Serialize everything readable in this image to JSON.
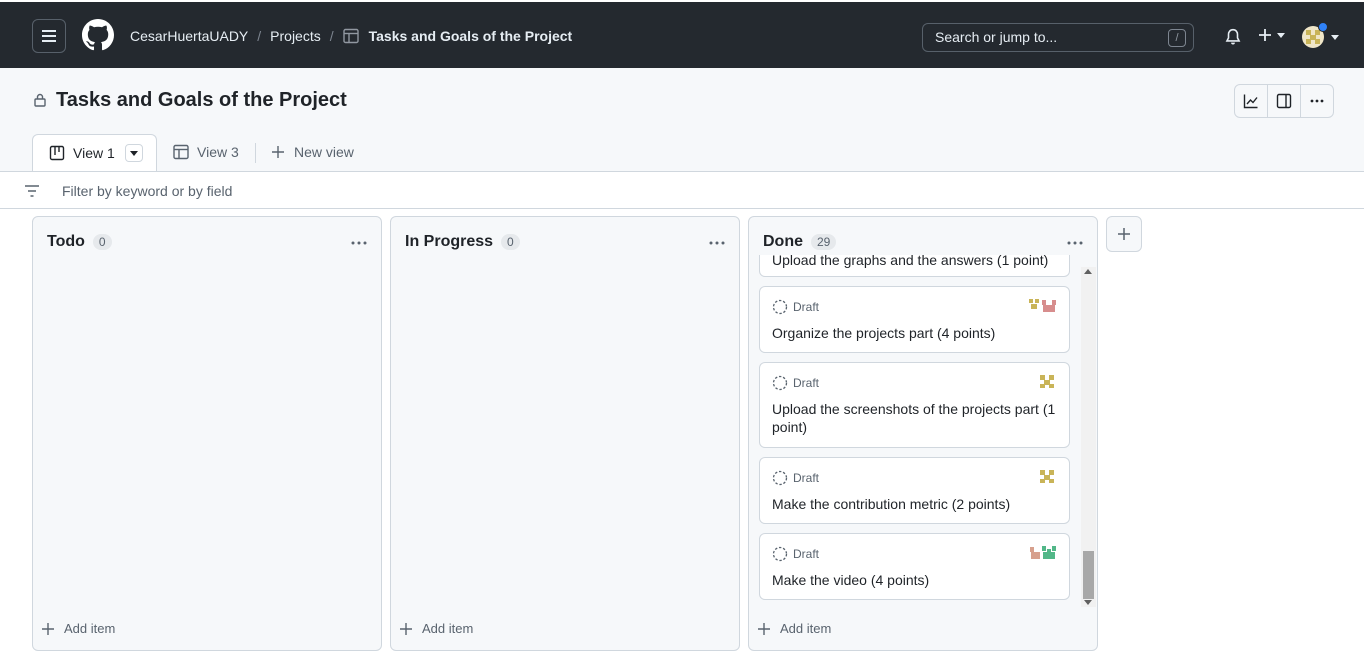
{
  "header": {
    "owner": "CesarHuertaUADY",
    "projects_label": "Projects",
    "project_title": "Tasks and Goals of the Project",
    "search_placeholder": "Search or jump to...",
    "search_shortcut": "/"
  },
  "project": {
    "title": "Tasks and Goals of the Project"
  },
  "tabs": [
    {
      "label": "View 1",
      "active": true,
      "icon": "board-icon"
    },
    {
      "label": "View 3",
      "active": false,
      "icon": "table-icon"
    },
    {
      "label": "New view",
      "active": false,
      "icon": "plus-icon"
    }
  ],
  "filter": {
    "placeholder": "Filter by keyword or by field"
  },
  "columns": [
    {
      "name": "Todo",
      "count": "0",
      "add_label": "Add item"
    },
    {
      "name": "In Progress",
      "count": "0",
      "add_label": "Add item"
    },
    {
      "name": "Done",
      "count": "29",
      "add_label": "Add item",
      "partial_card": "Upload the graphs and the answers (1 point)",
      "cards": [
        {
          "status": "Draft",
          "title": "Organize the projects part (4 points)"
        },
        {
          "status": "Draft",
          "title": "Upload the screenshots of the projects part (1 point)"
        },
        {
          "status": "Draft",
          "title": "Make the contribution metric (2 points)"
        },
        {
          "status": "Draft",
          "title": "Make the video (4 points)"
        }
      ]
    }
  ],
  "colors": {
    "header_bg": "#24292f",
    "accent_blue": "#2f81f7",
    "border": "#d0d7de"
  }
}
